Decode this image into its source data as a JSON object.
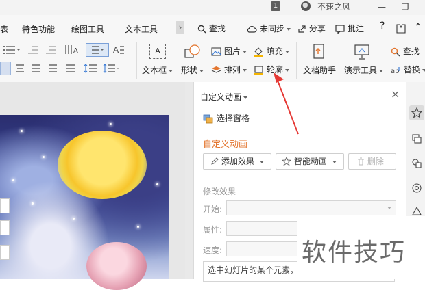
{
  "titlebar": {
    "doc_count": "1",
    "username": "不速之风",
    "minimize": "—",
    "restore": "❐"
  },
  "menu": {
    "tabs": [
      "表",
      "特色功能",
      "绘图工具",
      "文本工具"
    ],
    "more": "›",
    "search": "查找",
    "sync": "未同步",
    "share": "分享",
    "comment": "批注",
    "help": "?",
    "collapse": "⌃"
  },
  "ribbon": {
    "textbox": "文本框",
    "shape": "形状",
    "picture": "图片",
    "arrange": "排列",
    "fill": "填充",
    "outline": "轮廓",
    "doc_assistant": "文档助手",
    "presentation_tools": "演示工具",
    "find": "查找",
    "replace": "替换"
  },
  "panel": {
    "title": "自定义动画",
    "close": "×",
    "selection_pane": "选择窗格",
    "section_title": "自定义动画",
    "add_effect": "添加效果",
    "smart_animation": "智能动画",
    "delete": "删除",
    "modify_effect": "修改效果",
    "start_label": "开始:",
    "property_label": "属性:",
    "speed_label": "速度:",
    "description": "选中幻灯片的某个元素，"
  },
  "watermark": "软件技巧",
  "colors": {
    "accent": "#e3752e",
    "arrow": "#e53935"
  }
}
